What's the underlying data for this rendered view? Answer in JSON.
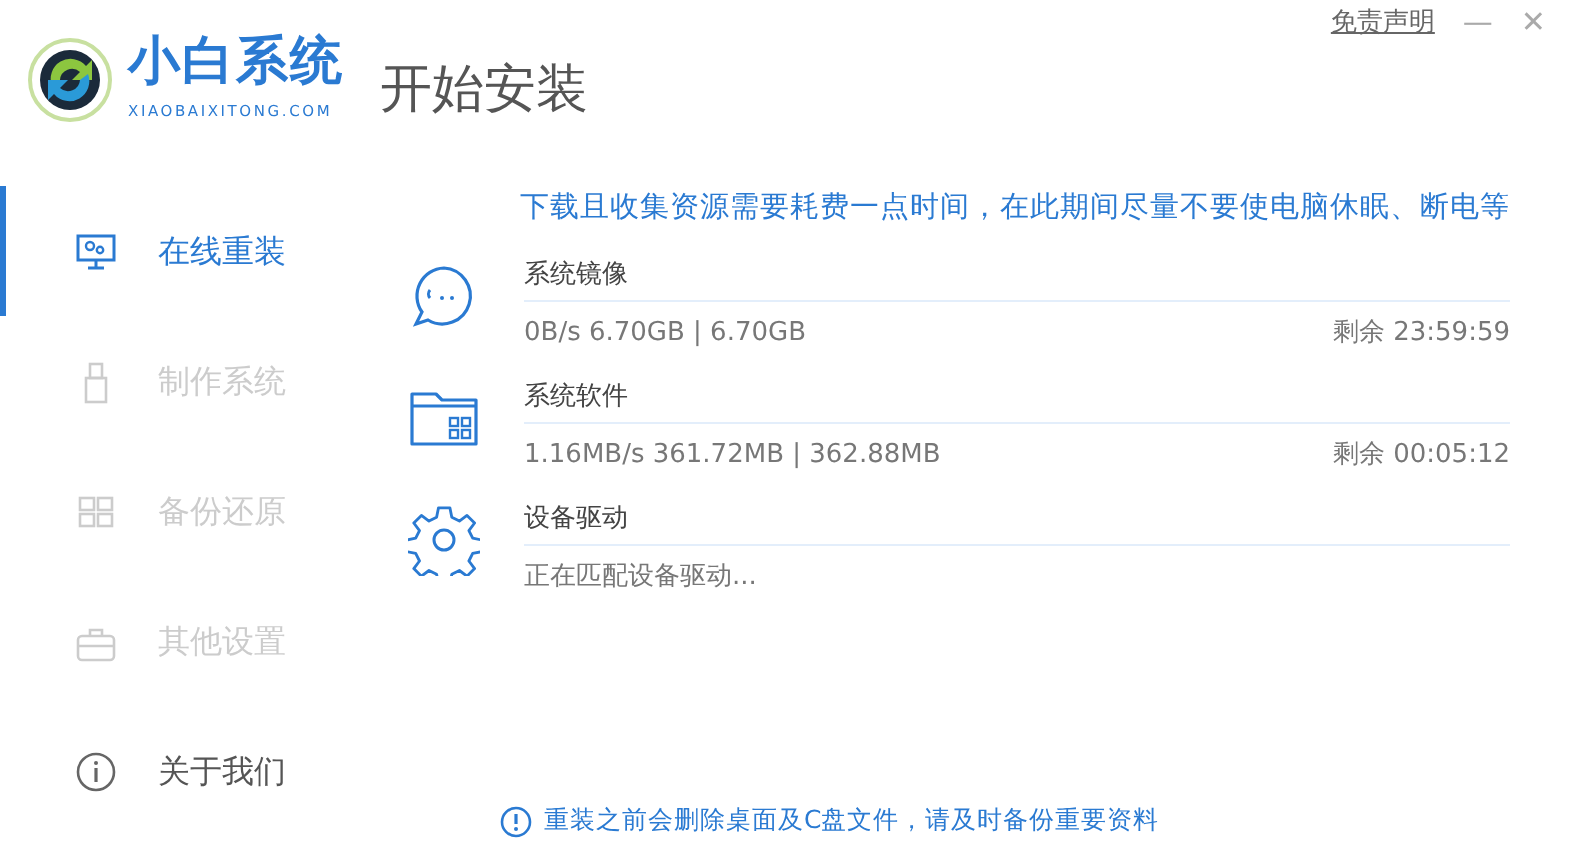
{
  "brand": {
    "name": "小白系统",
    "domain": "XIAOBAIXITONG.COM"
  },
  "page_title": "开始安装",
  "top_links": {
    "disclaimer": "免责声明",
    "minimize": "—",
    "close": "✕"
  },
  "sidebar": {
    "items": [
      {
        "label": "在线重装",
        "kind": "monitor",
        "selected": true,
        "disabled": false
      },
      {
        "label": "制作系统",
        "kind": "usb",
        "selected": false,
        "disabled": true
      },
      {
        "label": "备份还原",
        "kind": "grid",
        "selected": false,
        "disabled": true
      },
      {
        "label": "其他设置",
        "kind": "briefcase",
        "selected": false,
        "disabled": true
      },
      {
        "label": "关于我们",
        "kind": "info",
        "selected": false,
        "disabled": false
      }
    ]
  },
  "notice": "下载且收集资源需要耗费一点时间，在此期间尽量不要使电脑休眠、断电等",
  "downloads": [
    {
      "kind": "image",
      "name": "系统镜像",
      "stats": "0B/s 6.70GB | 6.70GB",
      "remaining": "剩余 23:59:59"
    },
    {
      "kind": "software",
      "name": "系统软件",
      "stats": "1.16MB/s 361.72MB | 362.88MB",
      "remaining": "剩余 00:05:12"
    },
    {
      "kind": "driver",
      "name": "设备驱动",
      "stats": "正在匹配设备驱动..."
    }
  ],
  "warning": "重装之前会删除桌面及C盘文件，请及时备份重要资料"
}
